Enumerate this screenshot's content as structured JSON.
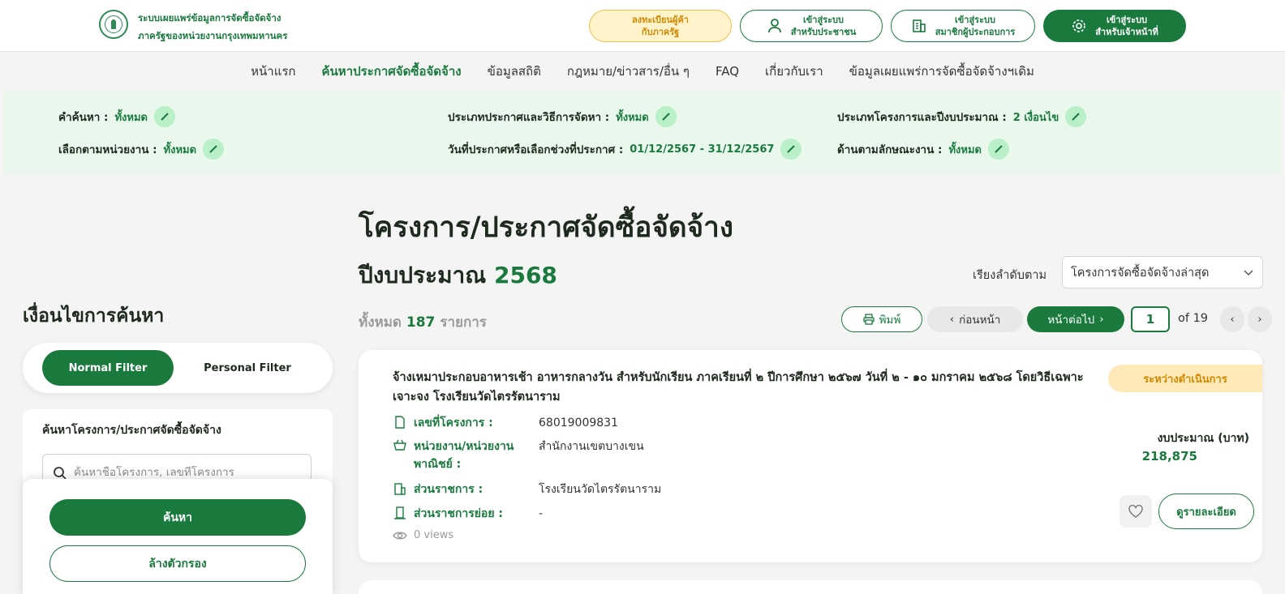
{
  "header": {
    "brand_line1": "ระบบเผยแพร่ข้อมูลการจัดซื้อจัดจ้าง",
    "brand_line2": "ภาครัฐของหน่วยงานกรุงเทพมหานคร",
    "register_line1": "ลงทะเบียนผู้ค้า",
    "register_line2": "กับภาครัฐ",
    "citizen_line1": "เข้าสู่ระบบ",
    "citizen_line2": "สำหรับประชาชน",
    "member_line1": "เข้าสู่ระบบ",
    "member_line2": "สมาชิกผู้ประกอบการ",
    "staff_line1": "เข้าสู่ระบบ",
    "staff_line2": "สำหรับเจ้าหน้าที่"
  },
  "nav": {
    "items": [
      {
        "label": "หน้าแรก"
      },
      {
        "label": "ค้นหาประกาศจัดซื้อจัดจ้าง"
      },
      {
        "label": "ข้อมูลสถิติ"
      },
      {
        "label": "กฎหมาย/ข่าวสาร/อื่น ๆ"
      },
      {
        "label": "FAQ"
      },
      {
        "label": "เกี่ยวกับเรา"
      },
      {
        "label": "ข้อมูลเผยแพร่การจัดซื้อจัดจ้างฯเดิม"
      }
    ],
    "active_index": 1
  },
  "summary": {
    "keyword_label": "คำค้นหา :",
    "keyword_value": "ทั้งหมด",
    "type_label": "ประเภทประกาศและวิธีการจัดหา :",
    "type_value": "ทั้งหมด",
    "project_label": "ประเภทโครงการและปีงบประมาณ :",
    "project_value": "2 เงื่อนไข",
    "agency_label": "เลือกตามหน่วยงาน :",
    "agency_value": "ทั้งหมด",
    "date_label": "วันที่ประกาศหรือเลือกช่วงที่ประกาศ :",
    "date_value": "01/12/2567 - 31/12/2567",
    "nature_label": "ด้านตามลักษณะงาน :",
    "nature_value": "ทั้งหมด"
  },
  "sidebar": {
    "title": "เงื่อนไขการค้นหา",
    "normal_filter": "Normal Filter",
    "personal_filter": "Personal Filter",
    "search_label": "ค้นหาโครงการ/ประกาศจัดซื้อจัดจ้าง",
    "search_placeholder": "ค้นหาชื่อโครงการ, เลขที่โครงการ",
    "search_button": "ค้นหา",
    "clear_button": "ล้างตัวกรอง"
  },
  "main": {
    "title": "โครงการ/ประกาศจัดซื้อจัดจ้าง",
    "fy_label": "ปีงบประมาณ",
    "fy_value": "2568",
    "sort_label": "เรียงลำดับตาม",
    "sort_value": "โครงการจัดซื้อจัดจ้างล่าสุด",
    "total_prefix": "ทั้งหมด",
    "total_count": "187",
    "total_suffix": "รายการ",
    "print_label": "พิมพ์",
    "prev_label": "ก่อนหน้า",
    "next_label": "หน้าต่อไป",
    "page_value": "1",
    "of_label": "of 19"
  },
  "card": {
    "title": "จ้างเหมาประกอบอาหารเช้า อาหารกลางวัน สำหรับนักเรียน ภาคเรียนที่ ๒ ปีการศึกษา ๒๕๖๗ วันที่ ๒ - ๑๐ มกราคม ๒๕๖๘ โดยวิธีเฉพาะเจาะจง โรงเรียนวัดไตรรัตนาราม",
    "status": "ระหว่างดำเนินการ",
    "project_no_label": "เลขที่โครงการ :",
    "project_no_value": "68019009831",
    "agency_label": "หน่วยงาน/หน่วยงานพาณิชย์ :",
    "agency_value": "สำนักงานเขตบางเขน",
    "division_label": "ส่วนราชการ :",
    "division_value": "โรงเรียนวัดไตรรัตนาราม",
    "subdivision_label": "ส่วนราชการย่อย :",
    "subdivision_value": "-",
    "views": "0 views",
    "budget_label": "งบประมาณ (บาท)",
    "budget_value": "218,875",
    "detail_button": "ดูรายละเอียด"
  },
  "colors": {
    "primary": "#1a7a3e",
    "status_bg": "#ffe9b8",
    "status_text": "#d08a00",
    "summary_bg": "#e9f7ed"
  }
}
